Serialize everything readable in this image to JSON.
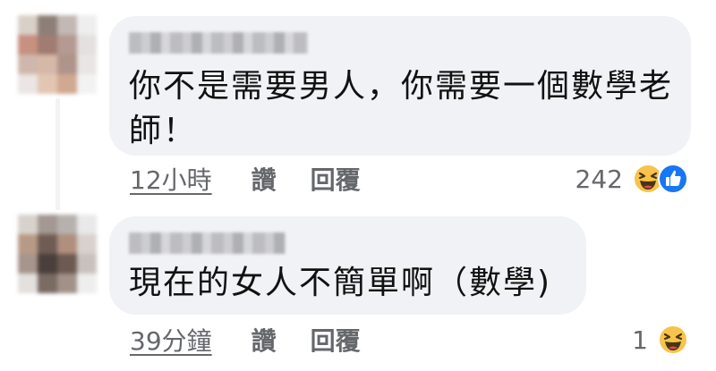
{
  "comments": [
    {
      "text": "你不是需要男人，你需要一個數學老師！",
      "timestamp": "12小時",
      "like_label": "讚",
      "reply_label": "回覆",
      "reaction_count": "242",
      "reactions": [
        "haha-icon",
        "like-icon"
      ]
    },
    {
      "text": "現在的女人不簡單啊（數學)",
      "timestamp": "39分鐘",
      "like_label": "讚",
      "reply_label": "回覆",
      "reaction_count": "1",
      "reactions": [
        "haha-icon"
      ]
    }
  ],
  "colors": {
    "bubble": "#f0f2f5",
    "meta_text": "#65676b",
    "haha_yellow": "#f7c34b",
    "like_blue": "#1877f2"
  }
}
